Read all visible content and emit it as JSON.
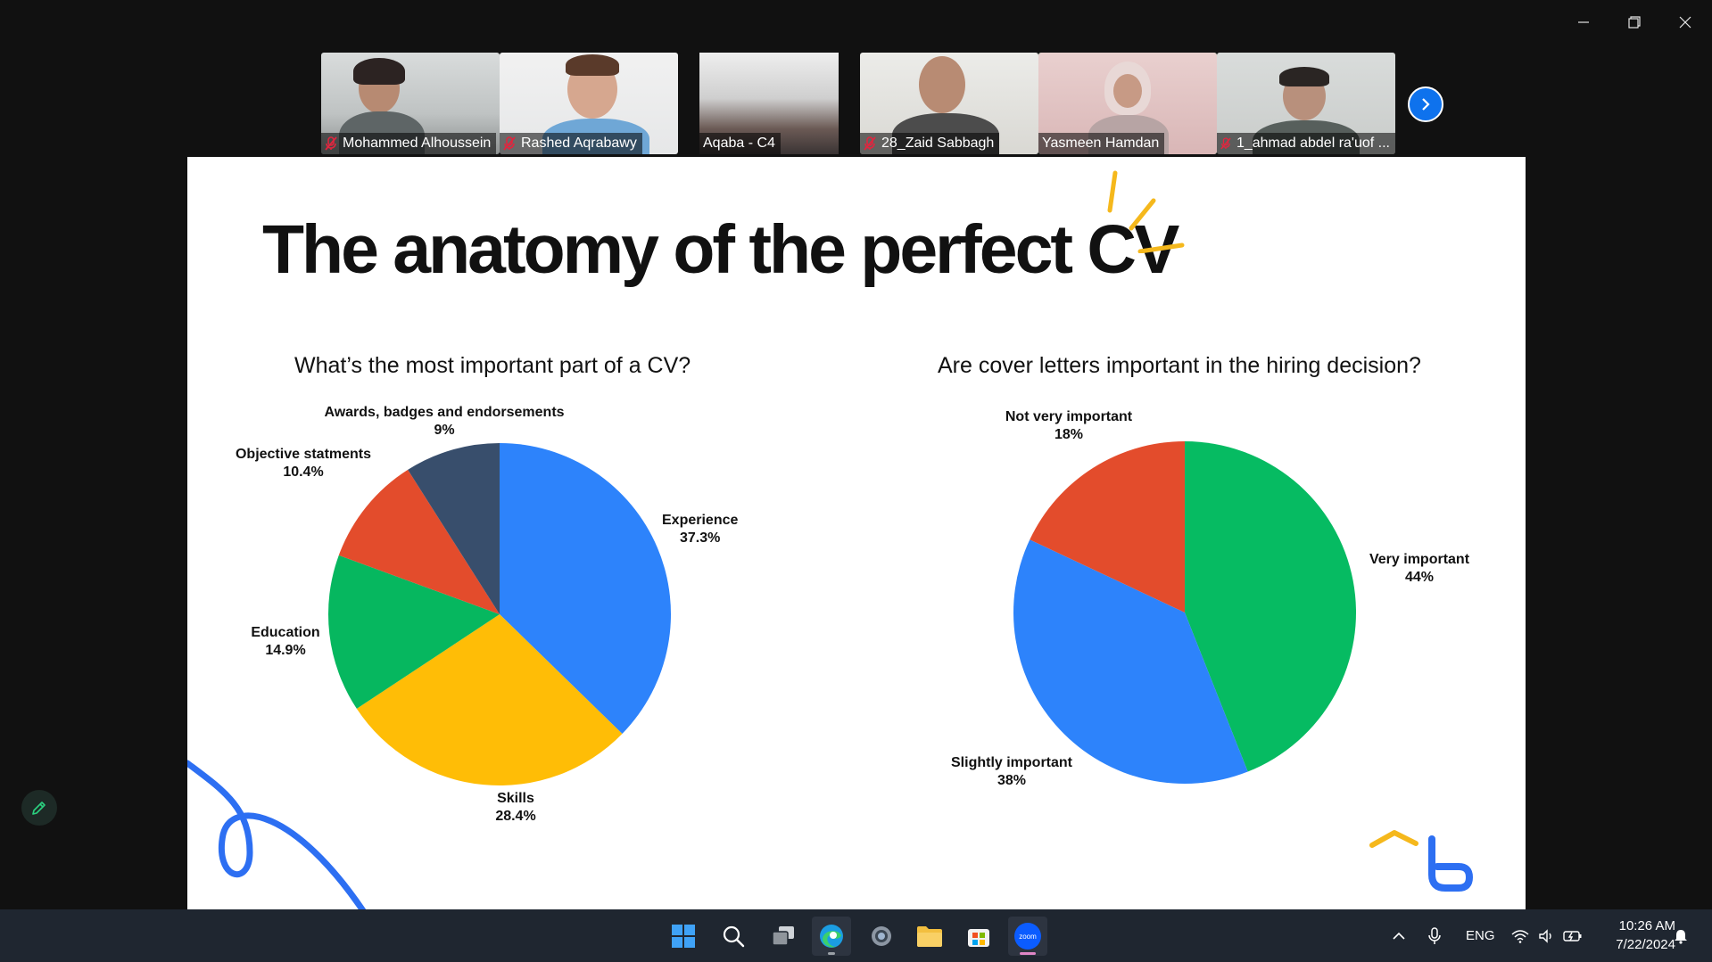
{
  "window": {
    "controls": [
      "minimize",
      "restore",
      "close"
    ]
  },
  "participants": [
    {
      "name": "Mohammed Alhoussein",
      "muted": true,
      "active": false
    },
    {
      "name": "Rashed Aqrabawy",
      "muted": true,
      "active": false
    },
    {
      "name": "Aqaba - C4",
      "muted": false,
      "active": false
    },
    {
      "name": "28_Zaid Sabbagh",
      "muted": true,
      "active": false
    },
    {
      "name": "Yasmeen Hamdan",
      "muted": false,
      "active": true
    },
    {
      "name": "1_ahmad abdel ra'uof ...",
      "muted": true,
      "active": false
    }
  ],
  "slide": {
    "title": "The anatomy of the perfect CV"
  },
  "chart_data": [
    {
      "type": "pie",
      "title": "What’s the most important part of a CV?",
      "slices": [
        {
          "label": "Experience",
          "value": 37.3,
          "value_label": "37.3%",
          "color": "#2d83fb"
        },
        {
          "label": "Skills",
          "value": 28.4,
          "value_label": "28.4%",
          "color": "#ffbd06"
        },
        {
          "label": "Education",
          "value": 14.9,
          "value_label": "14.9%",
          "color": "#06b75f"
        },
        {
          "label": "Objective statments",
          "value": 10.4,
          "value_label": "10.4%",
          "color": "#e34c2c"
        },
        {
          "label": "Awards, badges and endorsements",
          "value": 9,
          "value_label": "9%",
          "color": "#384e6c"
        }
      ]
    },
    {
      "type": "pie",
      "title": "Are cover letters important in the hiring decision?",
      "slices": [
        {
          "label": "Very important",
          "value": 44,
          "value_label": "44%",
          "color": "#06bb62"
        },
        {
          "label": "Slightly important",
          "value": 38,
          "value_label": "38%",
          "color": "#2d83fb"
        },
        {
          "label": "Not very important",
          "value": 18,
          "value_label": "18%",
          "color": "#e34c2c"
        }
      ]
    }
  ],
  "taskbar": {
    "apps": [
      "windows-start",
      "search",
      "task-view",
      "edge",
      "settings",
      "file-explorer",
      "microsoft-store",
      "zoom"
    ],
    "zoom_label": "zoom",
    "language": "ENG",
    "time": "10:26 AM",
    "date": "7/22/2024"
  }
}
